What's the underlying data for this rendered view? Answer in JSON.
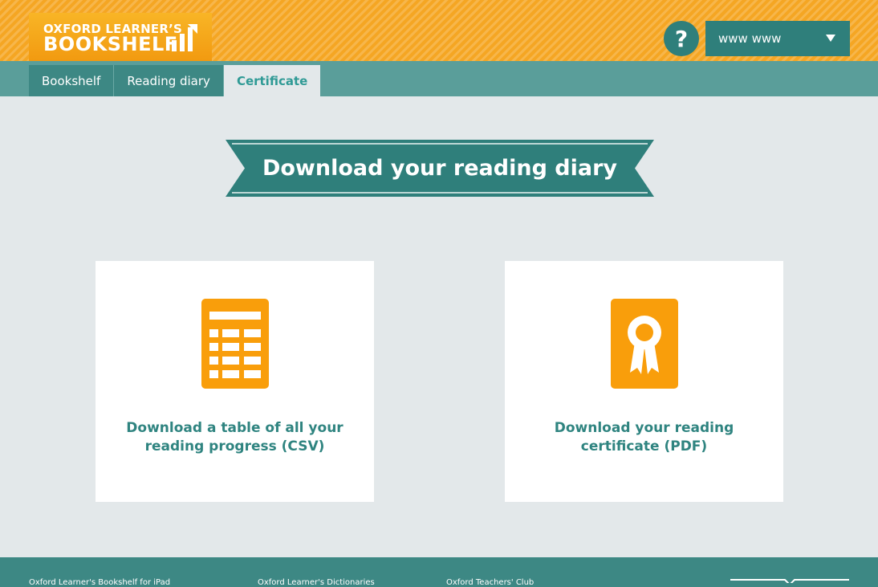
{
  "header": {
    "logo_line1": "OXFORD LEARNER’S",
    "logo_line2": "BOOKSHELF",
    "help_symbol": "?",
    "user_name": "www www",
    "help_icon": "question-mark-icon",
    "dropdown_icon": "chevron-down-icon"
  },
  "tabs": [
    {
      "label": "Bookshelf"
    },
    {
      "label": "Reading diary"
    },
    {
      "label": "Certificate"
    }
  ],
  "banner": {
    "title": "Download your reading diary"
  },
  "cards": {
    "csv": {
      "label": "Download a table of all your reading progress (CSV)",
      "icon": "spreadsheet-icon"
    },
    "pdf": {
      "label": "Download your reading certificate (PDF)",
      "icon": "certificate-ribbon-icon"
    }
  },
  "footer": {
    "links": [
      "Oxford Learner's Bookshelf for iPad",
      "Oxford Learner's Dictionaries",
      "Oxford Teachers' Club"
    ]
  },
  "colors": {
    "header_orange": "#f5a623",
    "teal_dark": "#2f7f7b",
    "teal_tabbar": "#5a9e9a",
    "teal_text": "#2f8480",
    "icon_orange": "#f99e0b",
    "page_bg": "#e3e8ea"
  }
}
